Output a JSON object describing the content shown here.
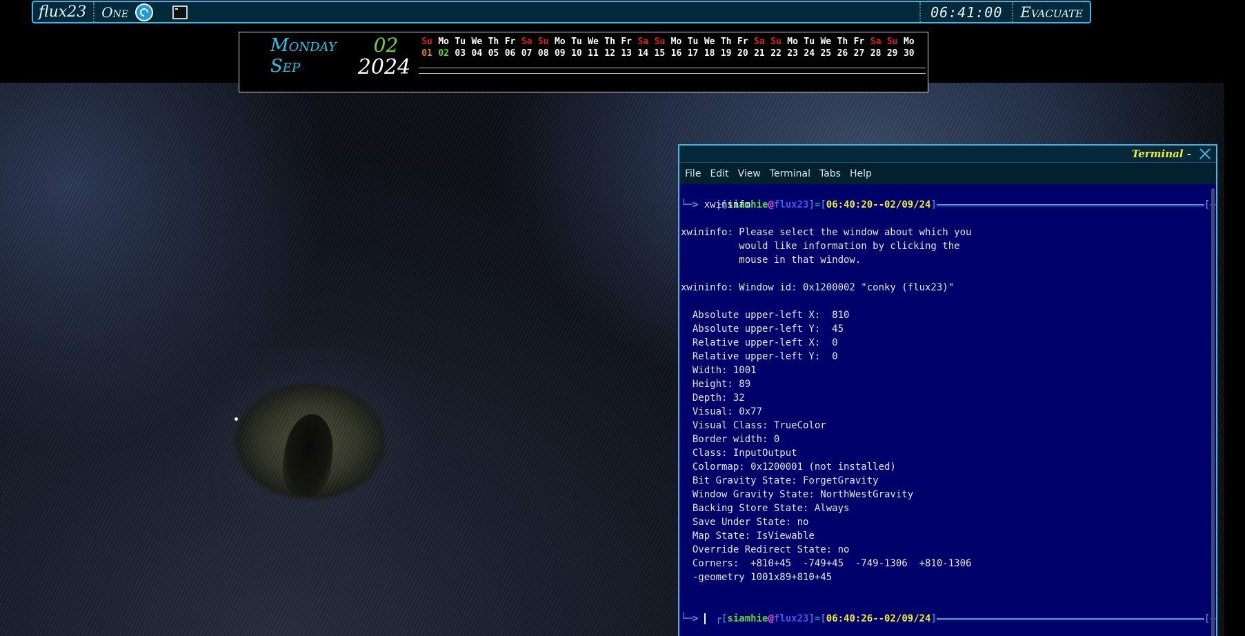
{
  "panel": {
    "logo": "flux23",
    "workspace": "One",
    "clock": "06:41:00",
    "exit_label": "Evacuate"
  },
  "conky": {
    "weekday": "Monday",
    "month": "Sep",
    "day": "02",
    "year": "2024",
    "weekday_headers": [
      "Su",
      "Mo",
      "Tu",
      "We",
      "Th",
      "Fr",
      "Sa",
      "Su",
      "Mo",
      "Tu",
      "We",
      "Th",
      "Fr",
      "Sa",
      "Su",
      "Mo",
      "Tu",
      "We",
      "Th",
      "Fr",
      "Sa",
      "Su",
      "Mo",
      "Tu",
      "We",
      "Th",
      "Fr",
      "Sa",
      "Su",
      "Mo"
    ],
    "dates": [
      "01",
      "02",
      "03",
      "04",
      "05",
      "06",
      "07",
      "08",
      "09",
      "10",
      "11",
      "12",
      "13",
      "14",
      "15",
      "16",
      "17",
      "18",
      "19",
      "20",
      "21",
      "22",
      "23",
      "24",
      "25",
      "26",
      "27",
      "28",
      "29",
      "30"
    ],
    "colors": {
      "weekday": "#24c8e8",
      "day": "#6ad83a",
      "weekend": "#e02020",
      "past": "#e08a20"
    }
  },
  "terminal": {
    "title": "Terminal -",
    "menu": [
      "File",
      "Edit",
      "View",
      "Terminal",
      "Tabs",
      "Help"
    ],
    "prompt1": {
      "user": "siamhie",
      "at": "@",
      "host": "flux23",
      "time": "06:40:20--02/09/24",
      "dir": "~"
    },
    "command": "xwininfo",
    "output": [
      "",
      "xwininfo: Please select the window about which you",
      "          would like information by clicking the",
      "          mouse in that window.",
      "",
      "xwininfo: Window id: 0x1200002 \"conky (flux23)\"",
      "",
      "  Absolute upper-left X:  810",
      "  Absolute upper-left Y:  45",
      "  Relative upper-left X:  0",
      "  Relative upper-left Y:  0",
      "  Width: 1001",
      "  Height: 89",
      "  Depth: 32",
      "  Visual: 0x77",
      "  Visual Class: TrueColor",
      "  Border width: 0",
      "  Class: InputOutput",
      "  Colormap: 0x1200001 (not installed)",
      "  Bit Gravity State: ForgetGravity",
      "  Window Gravity State: NorthWestGravity",
      "  Backing Store State: Always",
      "  Save Under State: no",
      "  Map State: IsViewable",
      "  Override Redirect State: no",
      "  Corners:  +810+45  -749+45  -749-1306  +810-1306",
      "  -geometry 1001x89+810+45",
      ""
    ],
    "prompt2": {
      "user": "siamhie",
      "at": "@",
      "host": "flux23",
      "time": "06:40:26--02/09/24",
      "dir": "~"
    }
  }
}
